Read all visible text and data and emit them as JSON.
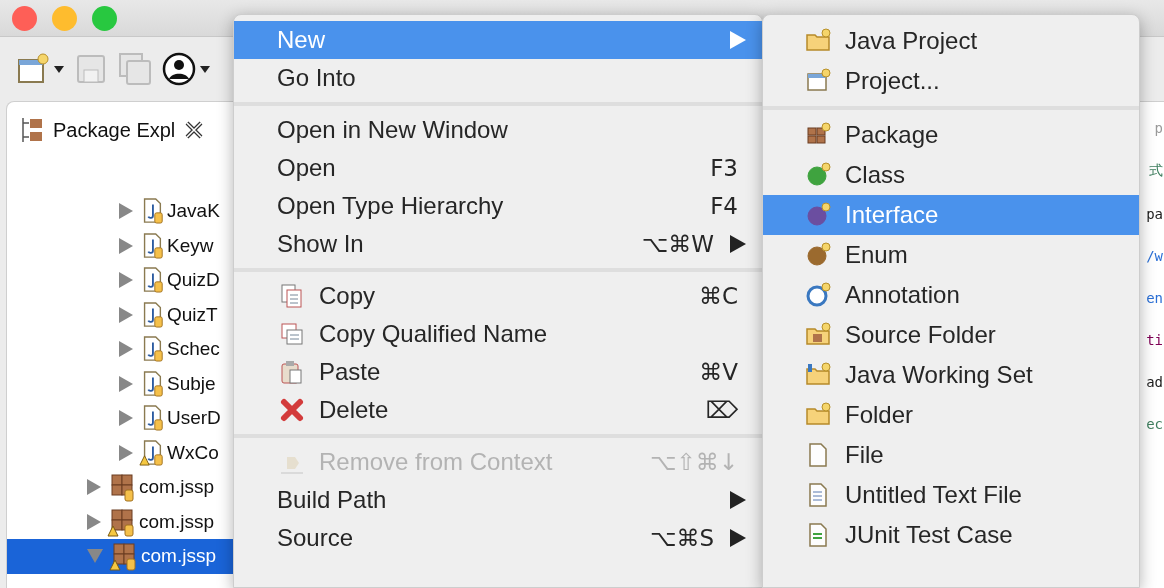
{
  "window": {
    "traffic_lights": [
      {
        "color": "#fe5f57"
      },
      {
        "color": "#febc2e"
      },
      {
        "color": "#28c840"
      }
    ]
  },
  "toolbar": [
    {
      "kind": "new-wizard",
      "dropdown": true,
      "disabled": false
    },
    {
      "kind": "save",
      "dropdown": false,
      "disabled": true
    },
    {
      "kind": "save-all",
      "dropdown": false,
      "disabled": true
    },
    {
      "kind": "account",
      "dropdown": true,
      "disabled": false
    }
  ],
  "explorer": {
    "tab": "Package Expl",
    "files": [
      {
        "label": "JavaK",
        "warning": false,
        "expanded": false
      },
      {
        "label": "Keyw",
        "warning": false,
        "expanded": false
      },
      {
        "label": "QuizD",
        "warning": false,
        "expanded": false
      },
      {
        "label": "QuizT",
        "warning": false,
        "expanded": false
      },
      {
        "label": "Schec",
        "warning": false,
        "expanded": false
      },
      {
        "label": "Subje",
        "warning": false,
        "expanded": false
      },
      {
        "label": "UserD",
        "warning": false,
        "expanded": false
      },
      {
        "label": "WxCo",
        "warning": true,
        "expanded": false
      }
    ],
    "packages": [
      {
        "label": "com.jssp",
        "warning": false,
        "expanded": false,
        "selected": false
      },
      {
        "label": "com.jssp",
        "warning": true,
        "expanded": false,
        "selected": false
      },
      {
        "label": "com.jssp",
        "warning": true,
        "expanded": true,
        "selected": true
      }
    ]
  },
  "editor": {
    "lines": [
      {
        "text": "p",
        "color": "#9a9a9a"
      },
      {
        "text": "式",
        "color": "#3f7f5f"
      },
      {
        "text": "pa",
        "color": "#1e1e1e"
      },
      {
        "text": "/w",
        "color": "#2a6fd6"
      },
      {
        "text": "en",
        "color": "#2a6fd6"
      },
      {
        "text": "ti",
        "color": "#7f0055"
      },
      {
        "text": "ad",
        "color": "#1e1e1e"
      },
      {
        "text": "ec",
        "color": "#3f7f5f"
      }
    ]
  },
  "context_menu": {
    "groups": [
      [
        {
          "label": "New",
          "kind": "plain",
          "submenu": true,
          "selected": true,
          "disabled": false
        },
        {
          "label": "Go Into",
          "kind": "plain",
          "submenu": false,
          "selected": false,
          "disabled": false
        }
      ],
      [
        {
          "label": "Open in New Window",
          "kind": "plain",
          "submenu": false,
          "selected": false,
          "disabled": false
        },
        {
          "label": "Open",
          "kind": "plain",
          "shortcut": "F3",
          "submenu": false,
          "selected": false,
          "disabled": false
        },
        {
          "label": "Open Type Hierarchy",
          "kind": "plain",
          "shortcut": "F4",
          "submenu": false,
          "selected": false,
          "disabled": false
        },
        {
          "label": "Show In",
          "kind": "plain",
          "shortcut": "⌥⌘W",
          "submenu": true,
          "selected": false,
          "disabled": false
        }
      ],
      [
        {
          "label": "Copy",
          "kind": "copy",
          "shortcut": "⌘C",
          "submenu": false,
          "selected": false,
          "disabled": false
        },
        {
          "label": "Copy Qualified Name",
          "kind": "copy-qualified",
          "submenu": false,
          "selected": false,
          "disabled": false
        },
        {
          "label": "Paste",
          "kind": "paste",
          "shortcut": "⌘V",
          "submenu": false,
          "selected": false,
          "disabled": false
        },
        {
          "label": "Delete",
          "kind": "delete",
          "shortcut": "⌦",
          "submenu": false,
          "selected": false,
          "disabled": false
        }
      ],
      [
        {
          "label": "Remove from Context",
          "kind": "remove",
          "shortcut": "⌥⇧⌘↓",
          "submenu": false,
          "selected": false,
          "disabled": true
        },
        {
          "label": "Build Path",
          "kind": "plain",
          "submenu": true,
          "selected": false,
          "disabled": false
        },
        {
          "label": "Source",
          "kind": "plain",
          "shortcut": "⌥⌘S",
          "submenu": true,
          "selected": false,
          "disabled": false
        }
      ]
    ]
  },
  "submenu": {
    "groups": [
      [
        {
          "label": "Java Project",
          "kind": "java-project",
          "selected": false
        },
        {
          "label": "Project...",
          "kind": "project",
          "selected": false
        }
      ],
      [
        {
          "label": "Package",
          "kind": "package",
          "selected": false
        },
        {
          "label": "Class",
          "kind": "class",
          "selected": false
        },
        {
          "label": "Interface",
          "kind": "interface",
          "selected": true
        },
        {
          "label": "Enum",
          "kind": "enum",
          "selected": false
        },
        {
          "label": "Annotation",
          "kind": "annotation",
          "selected": false
        },
        {
          "label": "Source Folder",
          "kind": "source-folder",
          "selected": false
        },
        {
          "label": "Java Working Set",
          "kind": "working-set",
          "selected": false
        },
        {
          "label": "Folder",
          "kind": "folder",
          "selected": false
        },
        {
          "label": "File",
          "kind": "file",
          "selected": false
        },
        {
          "label": "Untitled Text File",
          "kind": "text-file",
          "selected": false
        },
        {
          "label": "JUnit Test Case",
          "kind": "junit",
          "selected": false
        }
      ]
    ]
  }
}
